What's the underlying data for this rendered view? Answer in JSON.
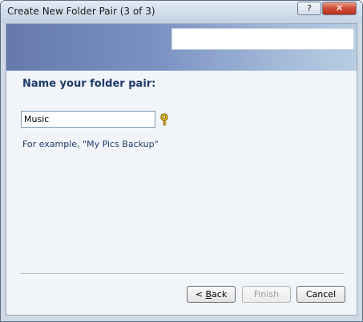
{
  "window": {
    "title": "Create New Folder Pair (3 of 3)",
    "help_label": "?",
    "close_label": "✕"
  },
  "page": {
    "heading": "Name your folder pair:",
    "name_value": "Music",
    "example_text": "For example, \"My Pics Backup\""
  },
  "buttons": {
    "back_prefix": "< ",
    "back_mnemonic": "B",
    "back_suffix": "ack",
    "finish": "Finish",
    "cancel": "Cancel",
    "finish_enabled": false
  },
  "icons": {
    "help": "help-key-icon"
  },
  "colors": {
    "banner_start": "#6579ad",
    "banner_end": "#b9cde3",
    "heading_text": "#1f3a6b",
    "content_bg": "#f1f5fa"
  }
}
